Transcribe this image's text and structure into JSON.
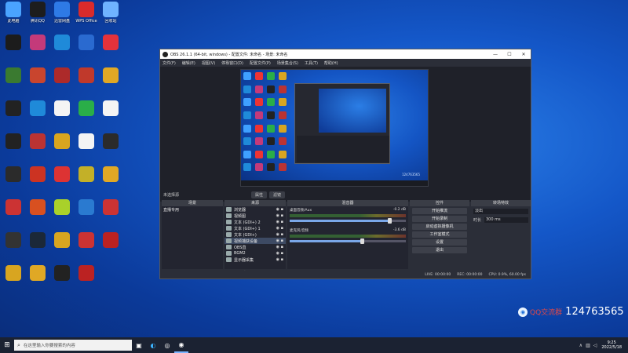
{
  "desktop": {
    "icons": [
      {
        "label": "此电脑",
        "icon": "computer-icon",
        "color": "#4aa3ff"
      },
      {
        "label": "腾讯QQ",
        "icon": "qq-icon",
        "color": "#1d1d1d"
      },
      {
        "label": "迅雷网盘",
        "icon": "cloud-icon",
        "color": "#2e7ae6"
      },
      {
        "label": "WPS Office",
        "icon": "wps-icon",
        "color": "#d92b2b"
      },
      {
        "label": "回收站",
        "icon": "recycle-bin-icon",
        "color": "#6fb3ff"
      },
      {
        "label": "",
        "icon": "app-icon",
        "color": "#1c1c1c"
      },
      {
        "label": "",
        "icon": "app-icon",
        "color": "#c43a7a"
      },
      {
        "label": "",
        "icon": "edge-icon",
        "color": "#1f8ad9"
      },
      {
        "label": "",
        "icon": "app-icon",
        "color": "#2a6ad0"
      },
      {
        "label": "",
        "icon": "music-icon",
        "color": "#e5323b"
      },
      {
        "label": "",
        "icon": "app-icon",
        "color": "#3a7a30"
      },
      {
        "label": "",
        "icon": "game-icon",
        "color": "#c9452e"
      },
      {
        "label": "",
        "icon": "app-icon",
        "color": "#ad2a2a"
      },
      {
        "label": "",
        "icon": "app-icon",
        "color": "#c0392b"
      },
      {
        "label": "",
        "icon": "app-icon",
        "color": "#e0a825"
      },
      {
        "label": "",
        "icon": "app-icon",
        "color": "#222"
      },
      {
        "label": "",
        "icon": "edge-icon",
        "color": "#1f8ad9"
      },
      {
        "label": "",
        "icon": "file-icon",
        "color": "#f4f4f4"
      },
      {
        "label": "",
        "icon": "wechat-icon",
        "color": "#2aae48"
      },
      {
        "label": "",
        "icon": "file-icon",
        "color": "#f4f4f4"
      },
      {
        "label": "",
        "icon": "nzxt-icon",
        "color": "#222"
      },
      {
        "label": "",
        "icon": "app-icon",
        "color": "#b33"
      },
      {
        "label": "",
        "icon": "app-icon",
        "color": "#d8a520"
      },
      {
        "label": "",
        "icon": "file-icon",
        "color": "#f4f4f4"
      },
      {
        "label": "",
        "icon": "obs-icon",
        "color": "#2b2b2b"
      },
      {
        "label": "",
        "icon": "obs-icon",
        "color": "#2b2b2b"
      },
      {
        "label": "",
        "icon": "app-icon",
        "color": "#c32"
      },
      {
        "label": "",
        "icon": "app-icon",
        "color": "#d33"
      },
      {
        "label": "",
        "icon": "app-icon",
        "color": "#c3b028"
      },
      {
        "label": "",
        "icon": "app-icon",
        "color": "#e0a825"
      },
      {
        "label": "",
        "icon": "app-icon",
        "color": "#c33"
      },
      {
        "label": "",
        "icon": "app-icon",
        "color": "#d85020"
      },
      {
        "label": "",
        "icon": "app-icon",
        "color": "#a9d12a"
      },
      {
        "label": "",
        "icon": "app-icon",
        "color": "#2a7ad0"
      },
      {
        "label": "",
        "icon": "app-icon",
        "color": "#c33"
      },
      {
        "label": "",
        "icon": "app-icon",
        "color": "#333"
      },
      {
        "label": "",
        "icon": "steam-icon",
        "color": "#1b2838"
      },
      {
        "label": "",
        "icon": "app-icon",
        "color": "#d8a520"
      },
      {
        "label": "",
        "icon": "app-icon",
        "color": "#c33"
      },
      {
        "label": "",
        "icon": "app-icon",
        "color": "#b22"
      },
      {
        "label": "",
        "icon": "app-icon",
        "color": "#d8a520"
      },
      {
        "label": "",
        "icon": "app-icon",
        "color": "#e0a825"
      },
      {
        "label": "",
        "icon": "app-icon",
        "color": "#222"
      },
      {
        "label": "",
        "icon": "app-icon",
        "color": "#b22"
      }
    ]
  },
  "obs": {
    "title": "OBS 26.1.1 (64-bit, windows) - 配置文件: 未命名 - 场景: 未命名",
    "menu": [
      "文件(F)",
      "编辑(E)",
      "视图(V)",
      "停靠窗口(D)",
      "配置文件(P)",
      "场景集合(S)",
      "工具(T)",
      "帮助(H)"
    ],
    "preview_watermark": "124763565",
    "scene_status": "未选择源",
    "ctrl_tabs": [
      "属性",
      "滤镜"
    ],
    "docks": {
      "scenes": {
        "header": "场景",
        "items": [
          "直播专用"
        ]
      },
      "sources": {
        "header": "来源",
        "items": [
          "浏览器",
          "视频图",
          "文本 (GDI+) 2",
          "文本 (GDI+) 1",
          "文本 (GDI+)",
          "视频捕获设备",
          "OBS直",
          "BGM2",
          "显示器采集"
        ]
      },
      "mixer": {
        "header": "混音器",
        "tracks": [
          {
            "name": "桌面音频/Aux",
            "db": "-0.2 dB",
            "level": 0.86
          },
          {
            "name": "麦克风/音频",
            "db": "-3.6 dB",
            "level": 0.62
          }
        ]
      },
      "controls": {
        "header": "控件",
        "buttons": [
          "开始推流",
          "开始录制",
          "启动虚拟摄像机",
          "工作室模式",
          "设置",
          "退出"
        ]
      },
      "transitions": {
        "header": "转场特效",
        "type": "淡出",
        "duration_label": "时长",
        "duration": "300 ms"
      }
    },
    "status": {
      "live": "LIVE: 00:00:00",
      "rec": "REC: 00:00:00",
      "cpu": "CPU: 0.9%, 60.00 fps"
    }
  },
  "qq_watermark": {
    "label": "QQ交流群",
    "number": "124763565"
  },
  "taskbar": {
    "search_placeholder": "在这里输入你要搜索的内容",
    "time": "9:25",
    "date": "2022/5/18"
  }
}
